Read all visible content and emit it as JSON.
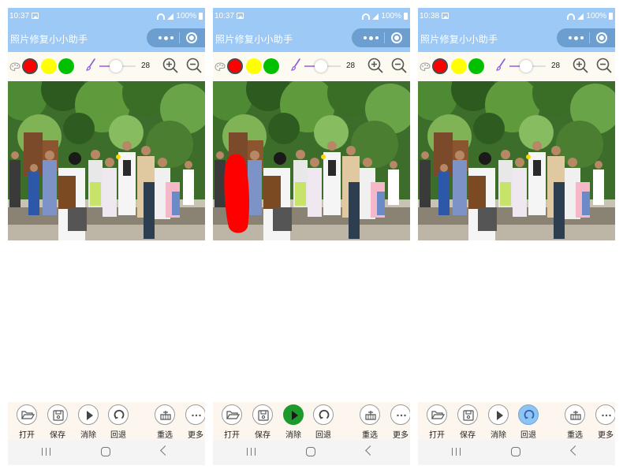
{
  "screens": [
    {
      "status": {
        "time": "10:37",
        "battery": "100%"
      },
      "app_title": "照片修复小小助手",
      "brush_size": "28",
      "mask_visible": false,
      "active_tool": "none",
      "toolbar": {
        "open": "打开",
        "save": "保存",
        "erase": "消除",
        "undo": "回退",
        "reselect": "重选",
        "more": "更多"
      }
    },
    {
      "status": {
        "time": "10:37",
        "battery": "100%"
      },
      "app_title": "照片修复小小助手",
      "brush_size": "28",
      "mask_visible": true,
      "active_tool": "erase",
      "toolbar": {
        "open": "打开",
        "save": "保存",
        "erase": "消除",
        "undo": "回退",
        "reselect": "重选",
        "more": "更多"
      }
    },
    {
      "status": {
        "time": "10:38",
        "battery": "100%"
      },
      "app_title": "照片修复小小助手",
      "brush_size": "28",
      "mask_visible": false,
      "active_tool": "undo",
      "toolbar": {
        "open": "打开",
        "save": "保存",
        "erase": "消除",
        "undo": "回退",
        "reselect": "重选",
        "more": "更多"
      }
    }
  ],
  "colors": {
    "header_bg": "#9cc9f5",
    "swatch_red": "#ff0000",
    "swatch_yellow": "#ffff00",
    "swatch_green": "#00c000",
    "erase_active": "#1c9a2c",
    "undo_active": "#8fc3f0",
    "mask": "#ff0000"
  },
  "icons": [
    "photo-icon",
    "wifi-icon",
    "signal-icon",
    "battery-icon",
    "more-dots-icon",
    "target-icon",
    "palette-icon",
    "brush-icon",
    "zoom-in-icon",
    "zoom-out-icon",
    "folder-open-icon",
    "save-disk-icon",
    "play-triangle-icon",
    "undo-arrow-icon",
    "reselect-icon",
    "ellipsis-icon"
  ]
}
